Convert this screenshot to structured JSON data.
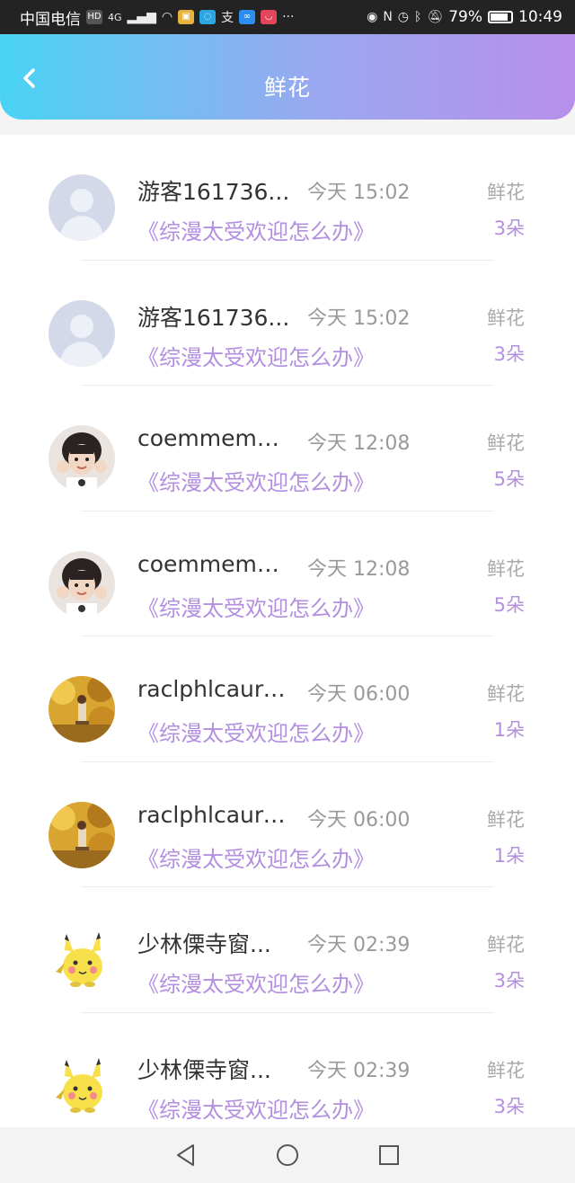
{
  "status_bar": {
    "carrier": "中国电信",
    "hd": "HD",
    "network": "4G",
    "battery": "79%",
    "time": "10:49"
  },
  "header": {
    "title": "鲜花"
  },
  "records": [
    {
      "nickname": "游客161736...",
      "time": "今天 15:02",
      "gift": "鲜花",
      "work": "《综漫太受欢迎怎么办》",
      "count": "3朵",
      "avatar": "default-avatar-icon"
    },
    {
      "nickname": "游客161736...",
      "time": "今天 15:02",
      "gift": "鲜花",
      "work": "《综漫太受欢迎怎么办》",
      "count": "3朵",
      "avatar": "default-avatar-icon"
    },
    {
      "nickname": "coemmemd...",
      "time": "今天 12:08",
      "gift": "鲜花",
      "work": "《综漫太受欢迎怎么办》",
      "count": "5朵",
      "avatar": "child-photo-avatar"
    },
    {
      "nickname": "coemmemd...",
      "time": "今天 12:08",
      "gift": "鲜花",
      "work": "《综漫太受欢迎怎么办》",
      "count": "5朵",
      "avatar": "child-photo-avatar"
    },
    {
      "nickname": "raclphlcaure...",
      "time": "今天 06:00",
      "gift": "鲜花",
      "work": "《综漫太受欢迎怎么办》",
      "count": "1朵",
      "avatar": "autumn-photo-avatar"
    },
    {
      "nickname": "raclphlcaure...",
      "time": "今天 06:00",
      "gift": "鲜花",
      "work": "《综漫太受欢迎怎么办》",
      "count": "1朵",
      "avatar": "autumn-photo-avatar"
    },
    {
      "nickname": "少林傈寺窗...",
      "time": "今天 02:39",
      "gift": "鲜花",
      "work": "《综漫太受欢迎怎么办》",
      "count": "3朵",
      "avatar": "pikachu-avatar"
    },
    {
      "nickname": "少林傈寺窗...",
      "time": "今天 02:39",
      "gift": "鲜花",
      "work": "《综漫太受欢迎怎么办》",
      "count": "3朵",
      "avatar": "pikachu-avatar"
    }
  ],
  "colors": {
    "header_gradient": [
      "#49d3f4",
      "#9aa8f0",
      "#b88feb"
    ],
    "accent_purple": "#b38fe0",
    "muted_gray": "#999999"
  },
  "nav_bar": {
    "back_icon": "triangle-back-icon",
    "home_icon": "circle-home-icon",
    "recents_icon": "square-recents-icon"
  }
}
